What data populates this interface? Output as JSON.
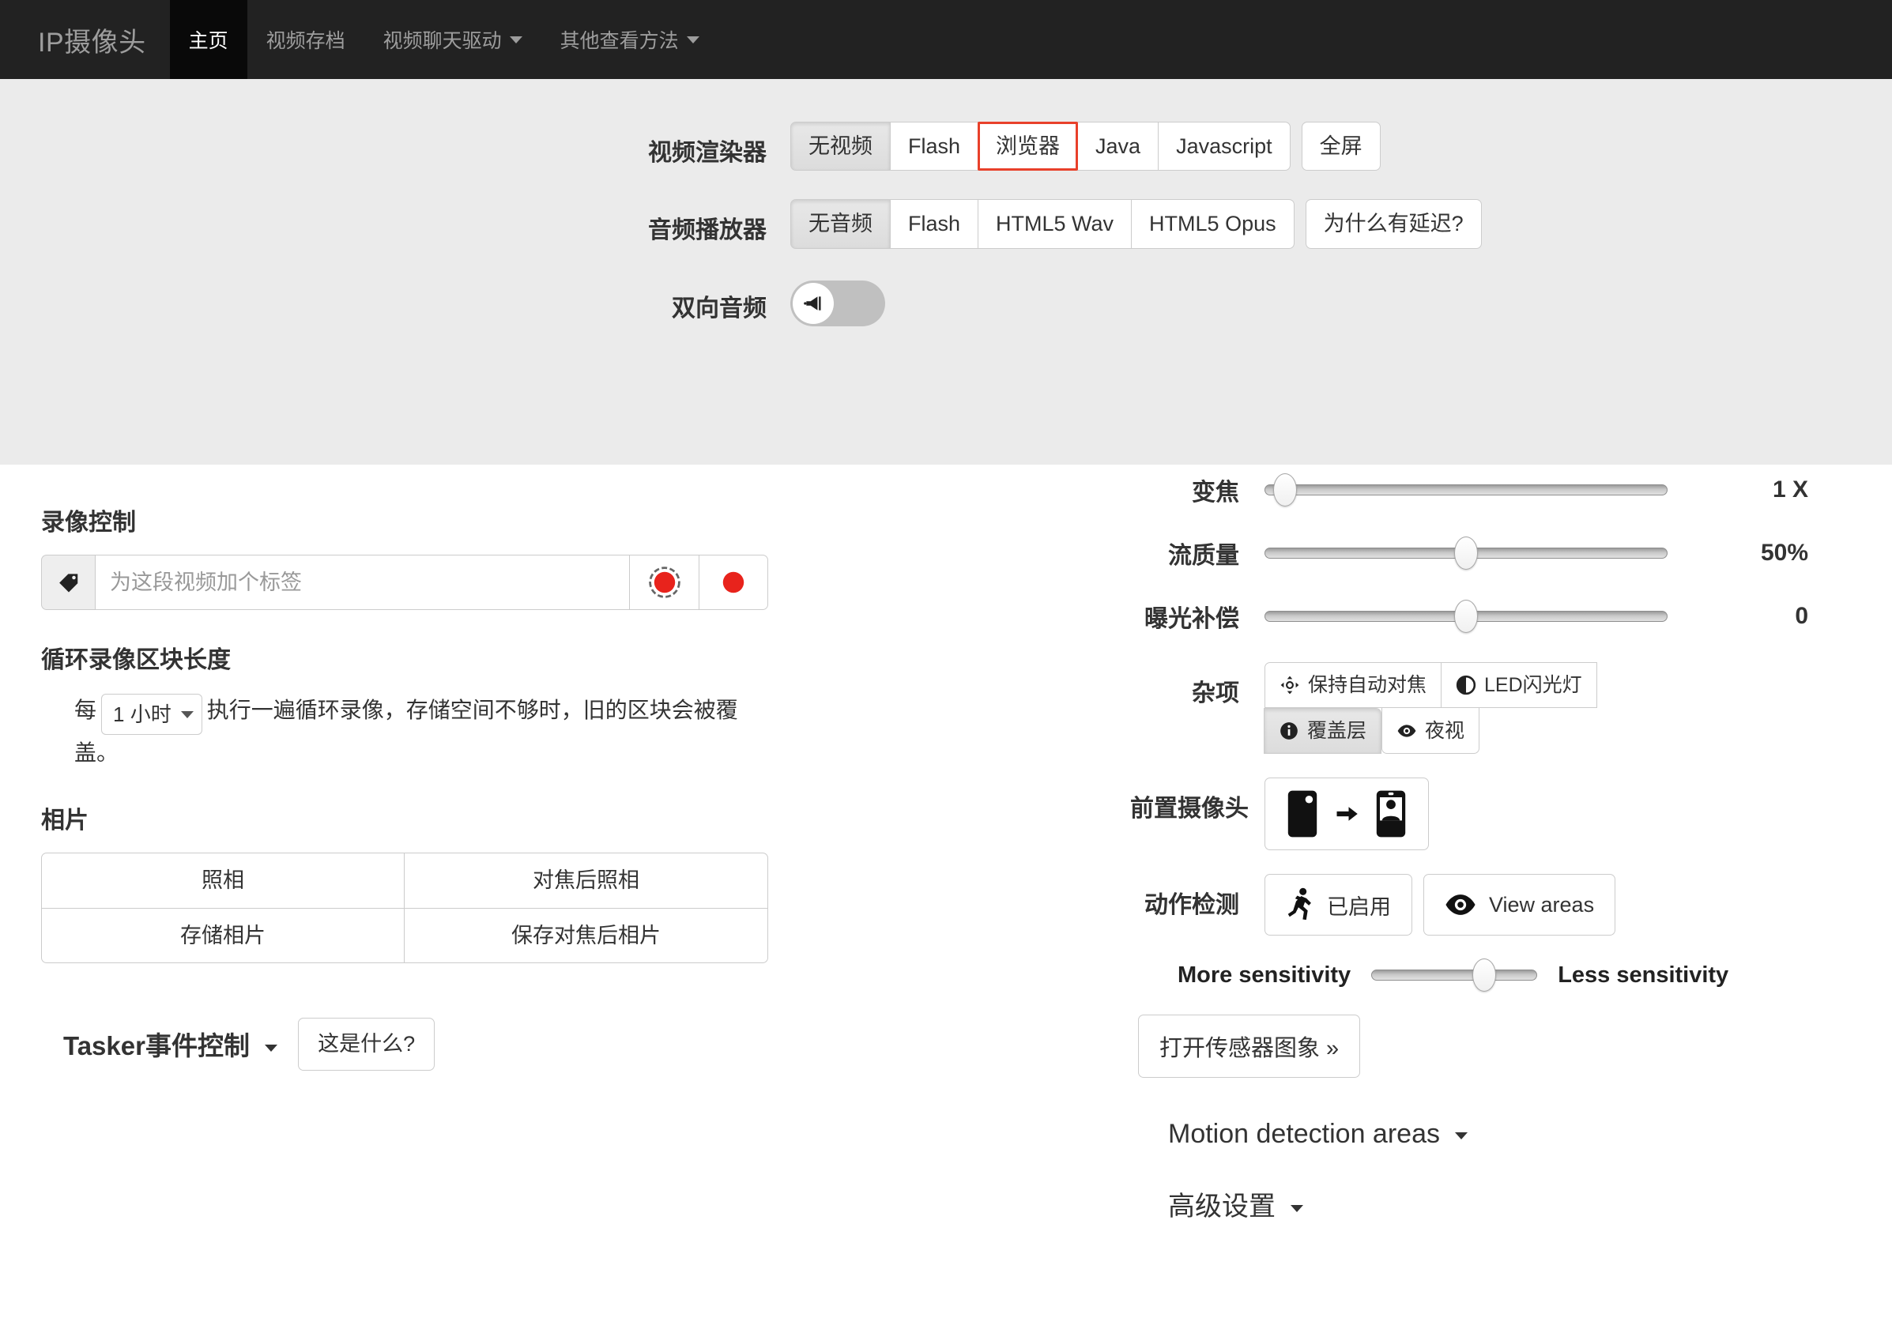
{
  "navbar": {
    "brand": "IP摄像头",
    "items": [
      {
        "label": "主页",
        "active": true,
        "caret": false
      },
      {
        "label": "视频存档",
        "active": false,
        "caret": false
      },
      {
        "label": "视频聊天驱动",
        "active": false,
        "caret": true
      },
      {
        "label": "其他查看方法",
        "active": false,
        "caret": true
      }
    ]
  },
  "settings": {
    "video_renderer": {
      "label": "视频渲染器",
      "options": [
        "无视频",
        "Flash",
        "浏览器",
        "Java",
        "Javascript"
      ],
      "active": "无视频",
      "selected_outline": "浏览器",
      "fullscreen_label": "全屏"
    },
    "audio_player": {
      "label": "音频播放器",
      "options": [
        "无音频",
        "Flash",
        "HTML5 Wav",
        "HTML5 Opus"
      ],
      "active": "无音频",
      "why_delay_label": "为什么有延迟?"
    },
    "two_way_audio": {
      "label": "双向音频",
      "state": "off",
      "icon": "megaphone-icon"
    }
  },
  "recording": {
    "heading": "录像控制",
    "tag_icon": "tag-icon",
    "tag_placeholder": "为这段视频加个标签",
    "tag_value": "",
    "record_toggle_icon": "record-ring-icon",
    "record_icon": "record-dot-icon"
  },
  "loop": {
    "heading": "循环录像区块长度",
    "prefix": "每",
    "duration": "1 小时",
    "suffix": "执行一遍循环录像，存储空间不够时，旧的区块会被覆盖。"
  },
  "photos": {
    "heading": "相片",
    "buttons": [
      "照相",
      "对焦后照相",
      "存储相片",
      "保存对焦后相片"
    ]
  },
  "tasker": {
    "title": "Tasker事件控制",
    "help_button": "这是什么?"
  },
  "camera_controls": {
    "sliders": [
      {
        "label": "变焦",
        "value": "1 X",
        "percent": 5
      },
      {
        "label": "流质量",
        "value": "50%",
        "percent": 50
      },
      {
        "label": "曝光补偿",
        "value": "0",
        "percent": 50
      }
    ],
    "misc": {
      "label": "杂项",
      "buttons": [
        {
          "label": "保持自动对焦",
          "icon": "focus-crosshair-icon",
          "active": false
        },
        {
          "label": "LED闪光灯",
          "icon": "half-circle-icon",
          "active": false
        },
        {
          "label": "覆盖层",
          "icon": "info-circle-icon",
          "active": true
        },
        {
          "label": "夜视",
          "icon": "eye-icon",
          "active": false
        }
      ]
    },
    "front_camera": {
      "label": "前置摄像头",
      "icon_from": "phone-back-icon",
      "icon_arrow": "arrow-right-icon",
      "icon_to": "phone-selfie-icon"
    },
    "motion_detection": {
      "label": "动作检测",
      "enabled_button": {
        "label": "已启用",
        "icon": "running-person-icon"
      },
      "view_areas_button": {
        "label": "View areas",
        "icon": "eye-open-icon"
      },
      "sensitivity_more": "More sensitivity",
      "sensitivity_less": "Less sensitivity",
      "sensitivity_percent": 68,
      "sensor_graph_button": "打开传感器图象 »"
    },
    "collapsibles": [
      {
        "label": "Motion detection areas"
      },
      {
        "label": "高级设置"
      }
    ]
  }
}
